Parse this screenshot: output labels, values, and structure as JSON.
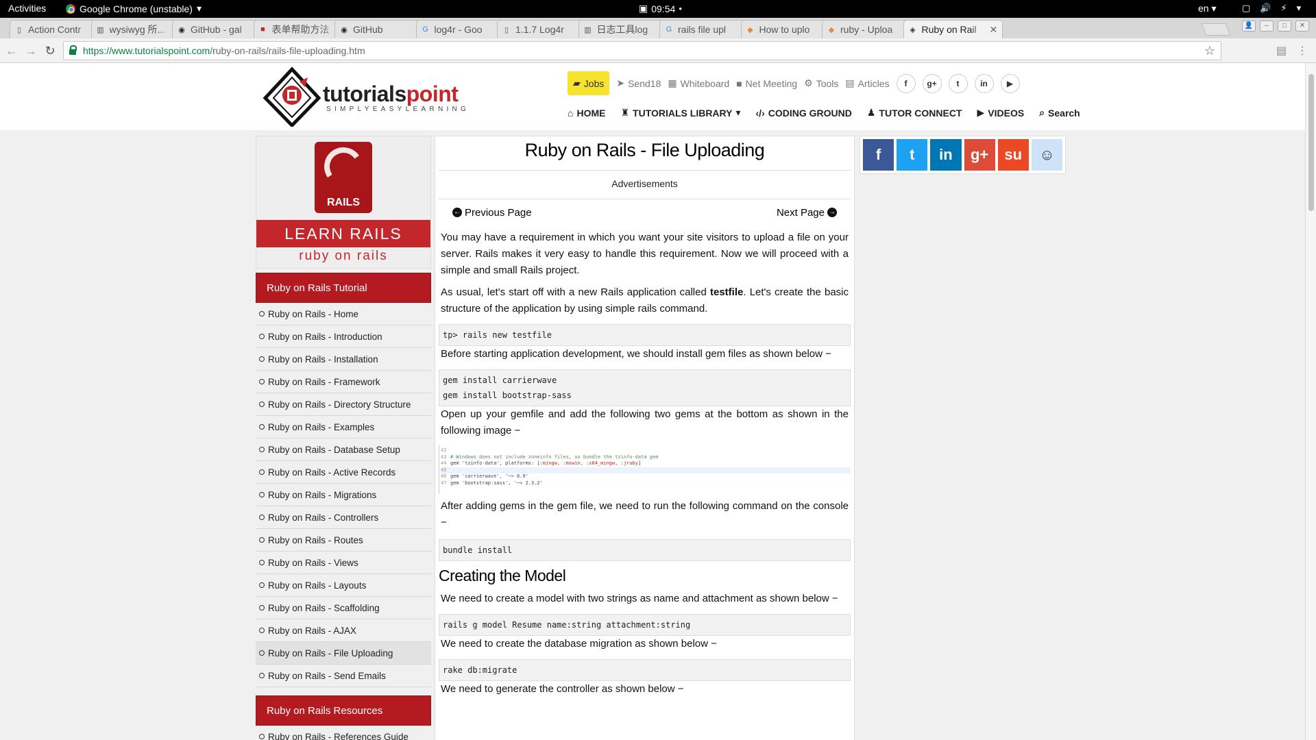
{
  "system": {
    "activities": "Activities",
    "app_menu": "Google Chrome (unstable)",
    "clock": "09:54",
    "lang": "en"
  },
  "tabs": [
    {
      "title": "Action Contr",
      "icon": "page-icon"
    },
    {
      "title": "wysiwyg 所...",
      "icon": "book-icon"
    },
    {
      "title": "GitHub - gal",
      "icon": "github-icon"
    },
    {
      "title": "表单帮助方法",
      "icon": "red-page-icon"
    },
    {
      "title": "GitHub",
      "icon": "github-icon"
    },
    {
      "title": "log4r - Goo",
      "icon": "google-icon"
    },
    {
      "title": "1.1.7 Log4r",
      "icon": "page-icon"
    },
    {
      "title": "日志工具log",
      "icon": "book-icon"
    },
    {
      "title": "rails file upl",
      "icon": "google-icon"
    },
    {
      "title": "How to uplo",
      "icon": "orange-icon"
    },
    {
      "title": "ruby - Uploa",
      "icon": "orange-icon"
    },
    {
      "title": "Ruby on Rail",
      "icon": "tp-icon",
      "active": true
    }
  ],
  "omnibox": {
    "host": "https://www.tutorialspoint.com",
    "path": "/ruby-on-rails/rails-file-uploading.htm"
  },
  "site": {
    "logo_word_a": "tutorials",
    "logo_word_b": "point",
    "logo_tag": "SIMPLYEASYLEARNING",
    "topnav": {
      "jobs": "Jobs",
      "send18": "Send18",
      "whiteboard": "Whiteboard",
      "net_meeting": "Net Meeting",
      "tools": "Tools",
      "articles": "Articles"
    },
    "social_round": [
      "f",
      "g+",
      "t",
      "in",
      "▶"
    ],
    "mainnav": {
      "home": "HOME",
      "tutorials_library": "TUTORIALS LIBRARY",
      "coding_ground": "CODING GROUND",
      "tutor_connect": "TUTOR CONNECT",
      "videos": "VIDEOS",
      "search": "Search"
    }
  },
  "sidebar": {
    "rails_badge": "RAILS",
    "learn_rails": "LEARN RAILS",
    "ruby_on_rails": "ruby on rails",
    "tutorial_heading": "Ruby on Rails Tutorial",
    "items": [
      "Ruby on Rails - Home",
      "Ruby on Rails - Introduction",
      "Ruby on Rails - Installation",
      "Ruby on Rails - Framework",
      "Ruby on Rails - Directory Structure",
      "Ruby on Rails - Examples",
      "Ruby on Rails - Database Setup",
      "Ruby on Rails - Active Records",
      "Ruby on Rails - Migrations",
      "Ruby on Rails - Controllers",
      "Ruby on Rails - Routes",
      "Ruby on Rails - Views",
      "Ruby on Rails - Layouts",
      "Ruby on Rails - Scaffolding",
      "Ruby on Rails - AJAX",
      "Ruby on Rails - File Uploading",
      "Ruby on Rails - Send Emails"
    ],
    "current_index": 15,
    "resources_heading": "Ruby on Rails Resources",
    "resources_first": "Ruby on Rails - References Guide"
  },
  "article": {
    "title": "Ruby on Rails - File Uploading",
    "ads": "Advertisements",
    "prev": "Previous Page",
    "next": "Next Page",
    "p1": "You may have a requirement in which you want your site visitors to upload a file on your server. Rails makes it very easy to handle this requirement. Now we will proceed with a simple and small Rails project.",
    "p2_a": "As usual, let's start off with a new Rails application called ",
    "p2_b": "testfile",
    "p2_c": ". Let's create the basic structure of the application by using simple rails command.",
    "code1": "tp> rails new testfile",
    "p3": "Before starting application development, we should install gem files as shown below −",
    "code2": "gem install carrierwave\ngem install bootstrap-sass",
    "p4": "Open up your gemfile and add the following two gems at the bottom as shown in the following image −",
    "gemfile": {
      "l42": "42",
      "l43": "43",
      "c43": "# Windows does not include zoneinfo files, so bundle the tzinfo-data gem",
      "l44": "44",
      "c44a": "gem 'tzinfo-data', platforms: [",
      "c44b": ":mingw, :mswin, :x64_mingw, :jruby",
      "c44c": "]",
      "l45": "45",
      "l46": "46",
      "c46": "gem 'carrierwave', '~> 0.9'",
      "l47": "47",
      "c47": "gem 'bootstrap-sass', '~> 2.3.2'"
    },
    "p5": "After adding gems in the gem file, we need to run the following command on the console −",
    "code3": "bundle install",
    "h2": "Creating the Model",
    "p6": "We need to create a model with two strings as name and attachment as shown below −",
    "code4": "rails g model Resume name:string attachment:string",
    "p7": "We need to create the database migration as shown below −",
    "code5": "rake db:migrate",
    "p8": "We need to generate the controller as shown below −"
  },
  "share_buttons": [
    {
      "label": "f",
      "color": "#3b5998",
      "icon": "facebook-icon"
    },
    {
      "label": "t",
      "color": "#1da1f2",
      "icon": "twitter-icon"
    },
    {
      "label": "in",
      "color": "#0077b5",
      "icon": "linkedin-icon"
    },
    {
      "label": "g+",
      "color": "#dd4b39",
      "icon": "googleplus-icon"
    },
    {
      "label": "su",
      "color": "#eb4924",
      "icon": "stumbleupon-icon"
    },
    {
      "label": "☺",
      "color": "#cee3f8",
      "icon": "reddit-icon"
    }
  ]
}
